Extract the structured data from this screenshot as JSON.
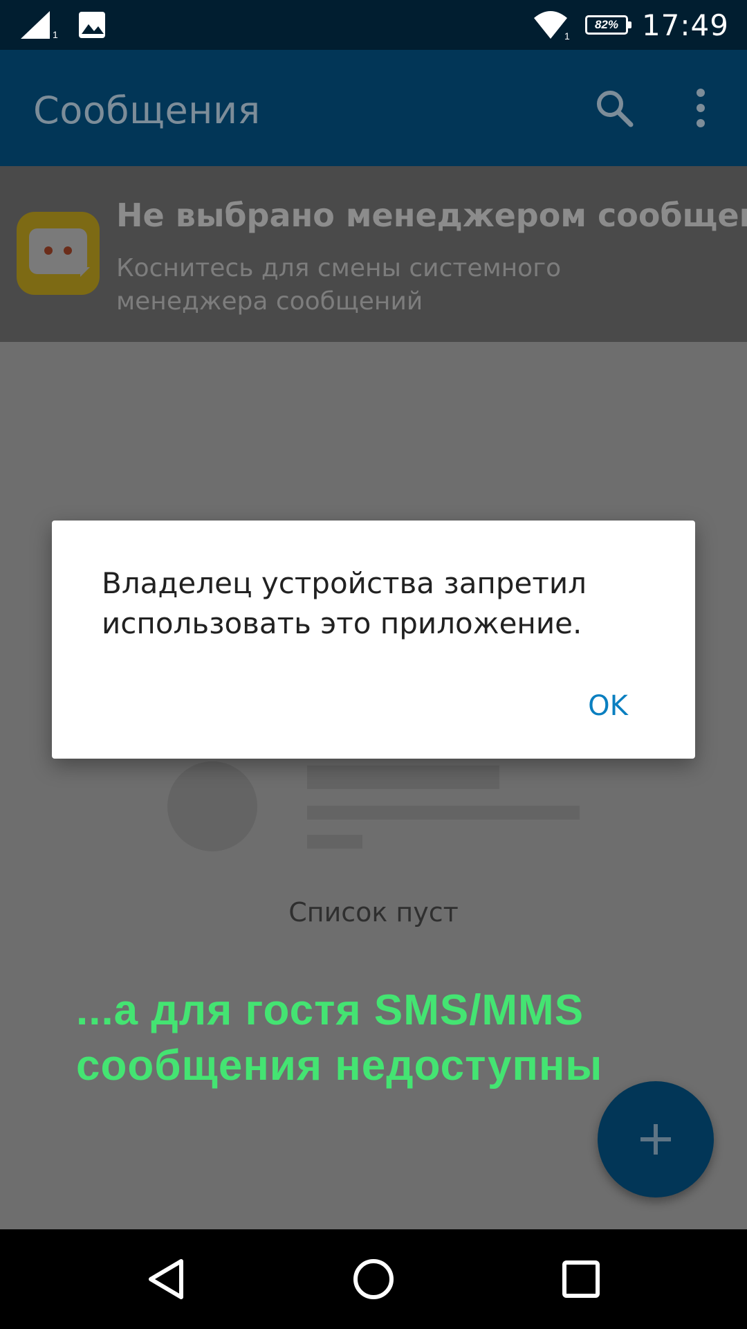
{
  "status_bar": {
    "sim_label": "1",
    "wifi_label": "1",
    "battery_percent": "82%",
    "time": "17:49",
    "icons": [
      "signal-icon",
      "image-notification-icon",
      "wifi-icon",
      "battery-icon"
    ]
  },
  "toolbar": {
    "title": "Сообщения",
    "icons": [
      "search-icon",
      "more-vert-icon"
    ]
  },
  "banner": {
    "title": "Не выбрано менеджером сообщений",
    "subtitle": "Коснитесь для смены системного менеджера сообщений",
    "icon": "messenger-app-icon"
  },
  "body": {
    "empty_label": "Список пуст",
    "caption": "...а  для  гостя SMS/MMS\nсообщения недоступны",
    "fab_icon": "plus-icon"
  },
  "dialog": {
    "message": "Владелец устройства запретил использовать это приложение.",
    "ok_label": "OK"
  },
  "nav_bar": {
    "icons": [
      "back-icon",
      "home-icon",
      "recents-icon"
    ]
  },
  "colors": {
    "status_bar": "#011e30",
    "toolbar": "#023657",
    "caption_green": "#44e472",
    "dialog_button": "#0a7fc0"
  }
}
